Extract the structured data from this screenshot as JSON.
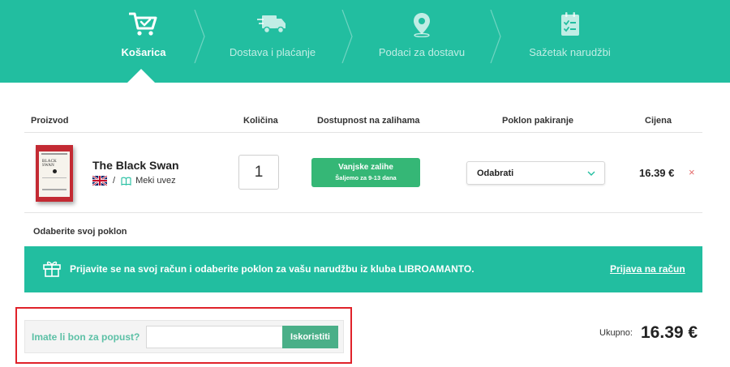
{
  "steps": [
    {
      "label": "Košarica",
      "icon": "cart-check-icon",
      "active": true
    },
    {
      "label": "Dostava i plaćanje",
      "icon": "delivery-truck-icon",
      "active": false
    },
    {
      "label": "Podaci za dostavu",
      "icon": "map-pin-icon",
      "active": false
    },
    {
      "label": "Sažetak narudžbi",
      "icon": "clipboard-checklist-icon",
      "active": false
    }
  ],
  "table": {
    "headers": {
      "product": "Proizvod",
      "quantity": "Količina",
      "availability": "Dostupnost na zalihama",
      "gift_wrap": "Poklon pakiranje",
      "price": "Cijena"
    },
    "item": {
      "title": "The Black Swan",
      "cover_icon": "book-cover-image",
      "language_icon": "uk-flag-icon",
      "separator": "/",
      "format_icon": "open-book-icon",
      "format": "Meki uvez",
      "quantity": "1",
      "stock_title": "Vanjske zalihe",
      "stock_note": "Šaljemo za 9-13 dana",
      "gift_wrap_value": "Odabrati",
      "price": "16.39 €",
      "remove_symbol": "×"
    }
  },
  "gift": {
    "title": "Odaberite svoj poklon",
    "message": "Prijavite se na svoj račun i odaberite poklon za vašu narudžbu iz kluba LIBROAMANTO.",
    "login_link": "Prijava na račun",
    "icon": "gift-icon"
  },
  "coupon": {
    "label": "Imate li bon za popust?",
    "input_value": "",
    "button": "Iskoristiti"
  },
  "total": {
    "label": "Ukupno:",
    "value": "16.39 €"
  },
  "colors": {
    "brand_teal": "#22bea0",
    "stock_green": "#35b776",
    "apply_button": "#4aaf88",
    "highlight_red": "#e0222a"
  }
}
